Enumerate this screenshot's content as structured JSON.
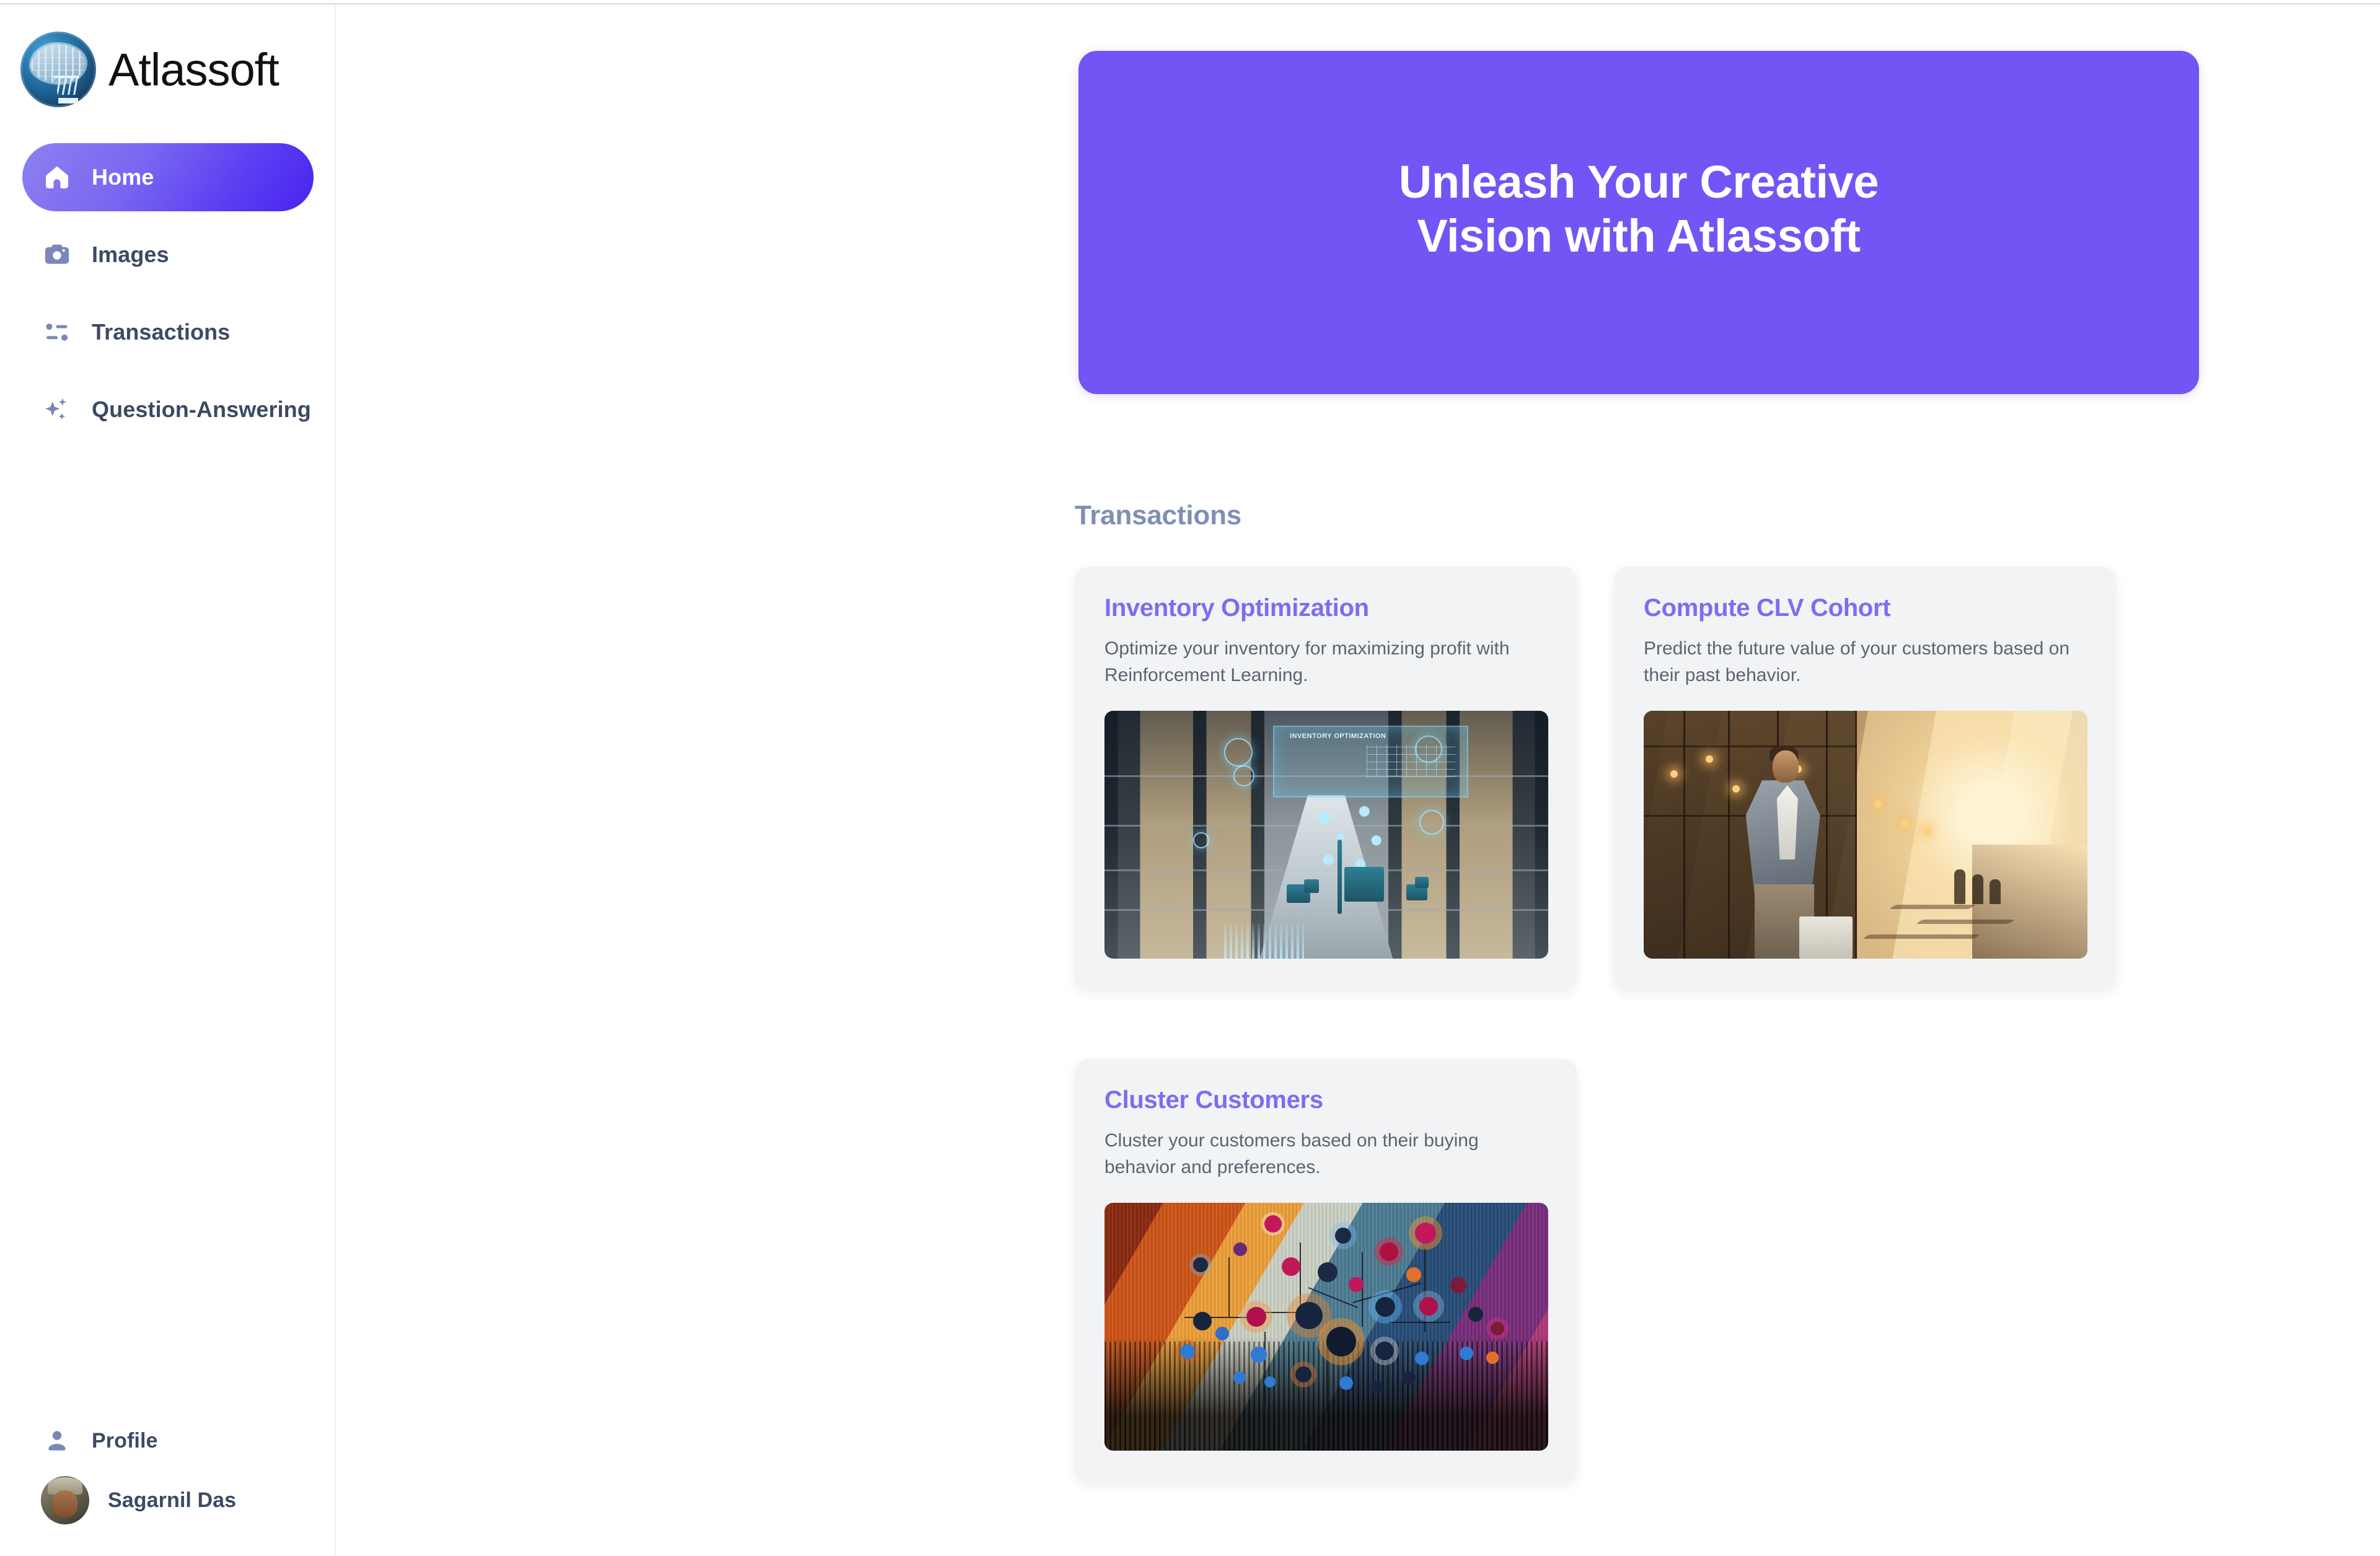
{
  "brand": {
    "name": "Atlassoft",
    "logo_icon": "brain-circuit-cart-logo"
  },
  "sidebar": {
    "items": [
      {
        "label": "Home",
        "icon": "home-icon",
        "active": true
      },
      {
        "label": "Images",
        "icon": "camera-icon",
        "active": false
      },
      {
        "label": "Transactions",
        "icon": "transactions-sliders-icon",
        "active": false
      },
      {
        "label": "Question-Answering",
        "icon": "sparkles-icon",
        "active": false
      }
    ],
    "bottom": [
      {
        "label": "Profile",
        "icon": "person-icon"
      },
      {
        "label": "Sagarnil Das",
        "icon": "user-avatar-photo"
      }
    ]
  },
  "hero": {
    "line1": "Unleash Your Creative",
    "line2": "Vision with Atlassoft",
    "background_color": "#7355f5",
    "text_color": "#ffffff"
  },
  "main": {
    "section_title": "Transactions",
    "section_title_color": "#7f8fb3",
    "card_title_color": "#7b6df0",
    "card_background": "#f2f3f5",
    "cards": [
      {
        "title": "Inventory Optimization",
        "description": "Optimize your inventory for maximizing profit with Reinforcement Learning.",
        "image_alt": "warehouse-aisle-with-forklifts-and-inventory-optimization-hologram",
        "image_overlay_text": "INVENTORY OPTIMIZATION"
      },
      {
        "title": "Compute CLV Cohort",
        "description": "Predict the future value of your customers based on their past behavior.",
        "image_alt": "man-in-blazer-with-shopping-bags-on-sunlit-shopping-street"
      },
      {
        "title": "Cluster Customers",
        "description": "Cluster your customers based on their buying behavior and preferences.",
        "image_alt": "network-of-connected-customer-person-icons-on-colorful-gradient"
      }
    ]
  }
}
